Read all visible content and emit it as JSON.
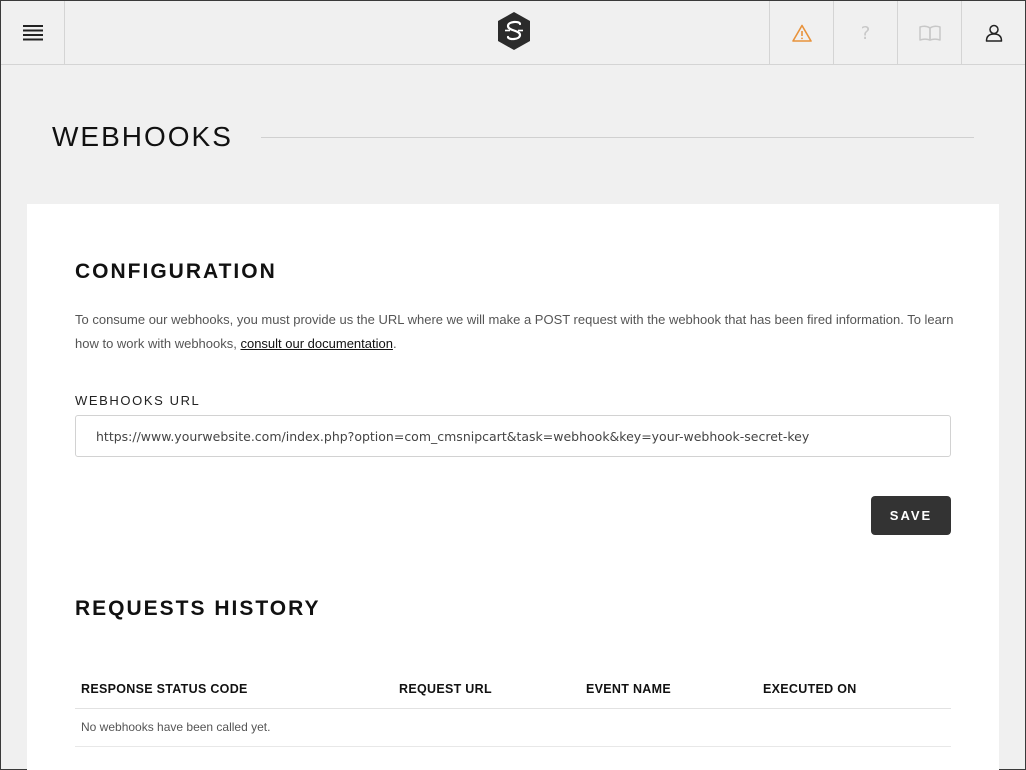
{
  "topbar": {
    "menu_icon": "hamburger-menu-icon",
    "logo_icon": "snipcart-logo-icon",
    "actions": [
      {
        "name": "warning-icon",
        "color": "#e8923b"
      },
      {
        "name": "help-icon",
        "glyph": "?"
      },
      {
        "name": "book-icon"
      },
      {
        "name": "user-icon"
      }
    ]
  },
  "page": {
    "title": "WEBHOOKS"
  },
  "configuration": {
    "heading": "CONFIGURATION",
    "description_before": "To consume our webhooks, you must provide us the URL where we will make a POST request with the webhook that has been fired information. To learn how to work with webhooks, ",
    "description_link": "consult our documentation",
    "description_after": ".",
    "url_label": "WEBHOOKS URL",
    "url_value": "https://www.yourwebsite.com/index.php?option=com_cmsnipcart&task=webhook&key=your-webhook-secret-key",
    "save_label": "SAVE"
  },
  "history": {
    "heading": "REQUESTS HISTORY",
    "columns": [
      "RESPONSE STATUS CODE",
      "REQUEST URL",
      "EVENT NAME",
      "EXECUTED ON"
    ],
    "empty_message": "No webhooks have been called yet."
  },
  "colors": {
    "accent_warning": "#e8923b",
    "button_bg": "#333333",
    "page_bg": "#f0f0f0"
  }
}
